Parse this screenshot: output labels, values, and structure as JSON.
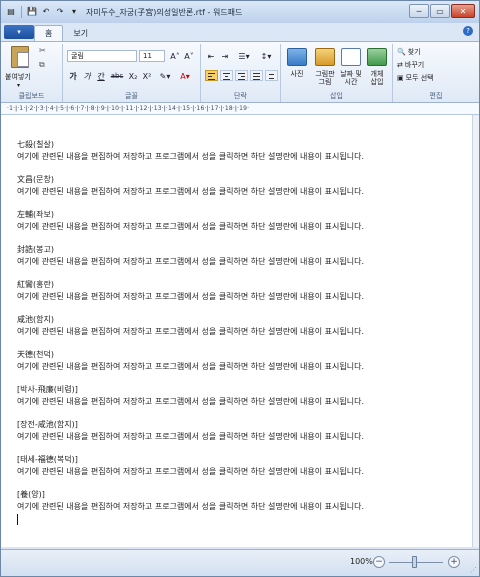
{
  "title_bar": {
    "title": "자미두수_자궁(子宮)의성일반론.rtf - 워드패드",
    "qa_save": "💾",
    "qa_undo": "↶",
    "qa_redo": "↷",
    "qa_more": "▾"
  },
  "window_controls": {
    "minimize": "─",
    "restore": "▭",
    "close": "✕"
  },
  "tabs": {
    "app_menu": "▾",
    "home": "홈",
    "view": "보기"
  },
  "help_glyph": "?",
  "ribbon": {
    "clipboard": {
      "paste": "붙여넣기",
      "arrow": "▾",
      "label": "클립보드",
      "cut": "✂",
      "copy": "⧉"
    },
    "font": {
      "name": "굴림",
      "size": "11",
      "grow": "A˄",
      "shrink": "A˅",
      "bold": "가",
      "italic": "가",
      "underline": "간",
      "strike": "abc",
      "subscript": "X₂",
      "superscript": "X²",
      "highlight": "✎▾",
      "color": "A▾",
      "label": "글꼴"
    },
    "paragraph": {
      "label": "단락",
      "list": "☰▾",
      "spacing": "↕▾",
      "indent_dec": "⇤",
      "indent_inc": "⇥"
    },
    "insert": {
      "picture": "사진",
      "paint": "그림판\n그림",
      "datetime": "날짜 및\n시간",
      "object": "개체\n삽입",
      "label": "삽입"
    },
    "editing": {
      "find": "찾기",
      "replace": "바꾸기",
      "select_all": "모두 선택",
      "label": "편집"
    }
  },
  "ruler_text": "·1·ǀ·1·ǀ·2·ǀ·3·ǀ·4·ǀ·5·ǀ·6·ǀ·7·ǀ·8·ǀ·9·ǀ·10·ǀ·11·ǀ·12·ǀ·13·ǀ·14·ǀ·15·ǀ·16·ǀ·17·ǀ·18·ǀ·19·",
  "document": {
    "entries": [
      {
        "title": "七殺(칠살)",
        "body": "여기에 관련된 내용을 편집하여 저장하고 프로그램에서 성을 클릭하면 하단 설명란에 내용이 표시됩니다."
      },
      {
        "title": "文昌(문창)",
        "body": "여기에 관련된 내용을 편집하여 저장하고 프로그램에서 성을 클릭하면 하단 설명란에 내용이 표시됩니다."
      },
      {
        "title": "左輔(좌보)",
        "body": "여기에 관련된 내용을 편집하여 저장하고 프로그램에서 성을 클릭하면 하단 설명란에 내용이 표시됩니다."
      },
      {
        "title": "封誥(봉고)",
        "body": "여기에 관련된 내용을 편집하여 저장하고 프로그램에서 성을 클릭하면 하단 설명란에 내용이 표시됩니다."
      },
      {
        "title": "紅鸞(홍란)",
        "body": "여기에 관련된 내용을 편집하여 저장하고 프로그램에서 성을 클릭하면 하단 설명란에 내용이 표시됩니다."
      },
      {
        "title": "咸池(함지)",
        "body": "여기에 관련된 내용을 편집하여 저장하고 프로그램에서 성을 클릭하면 하단 설명란에 내용이 표시됩니다."
      },
      {
        "title": "天德(천덕)",
        "body": "여기에 관련된 내용을 편집하여 저장하고 프로그램에서 성을 클릭하면 하단 설명란에 내용이 표시됩니다."
      },
      {
        "title": "[박사-飛廉(비렴)]",
        "body": "여기에 관련된 내용을 편집하여 저장하고 프로그램에서 성을 클릭하면 하단 설명란에 내용이 표시됩니다."
      },
      {
        "title": "[장전-咸池(함지)]",
        "body": "여기에 관련된 내용을 편집하여 저장하고 프로그램에서 성을 클릭하면 하단 설명란에 내용이 표시됩니다."
      },
      {
        "title": "[태세-福德(복덕)]",
        "body": "여기에 관련된 내용을 편집하여 저장하고 프로그램에서 성을 클릭하면 하단 설명란에 내용이 표시됩니다."
      },
      {
        "title": "[養(양)]",
        "body": "여기에 관련된 내용을 편집하여 저장하고 프로그램에서 성을 클릭하면 하단 설명란에 내용이 표시됩니다."
      }
    ]
  },
  "status_bar": {
    "zoom": "100%",
    "zoom_out": "−",
    "zoom_in": "+",
    "grip": "⋰"
  },
  "colors": {
    "accent": "#2d6bc4",
    "ribbon": "#dfe9f6",
    "page": "#ffffff"
  }
}
